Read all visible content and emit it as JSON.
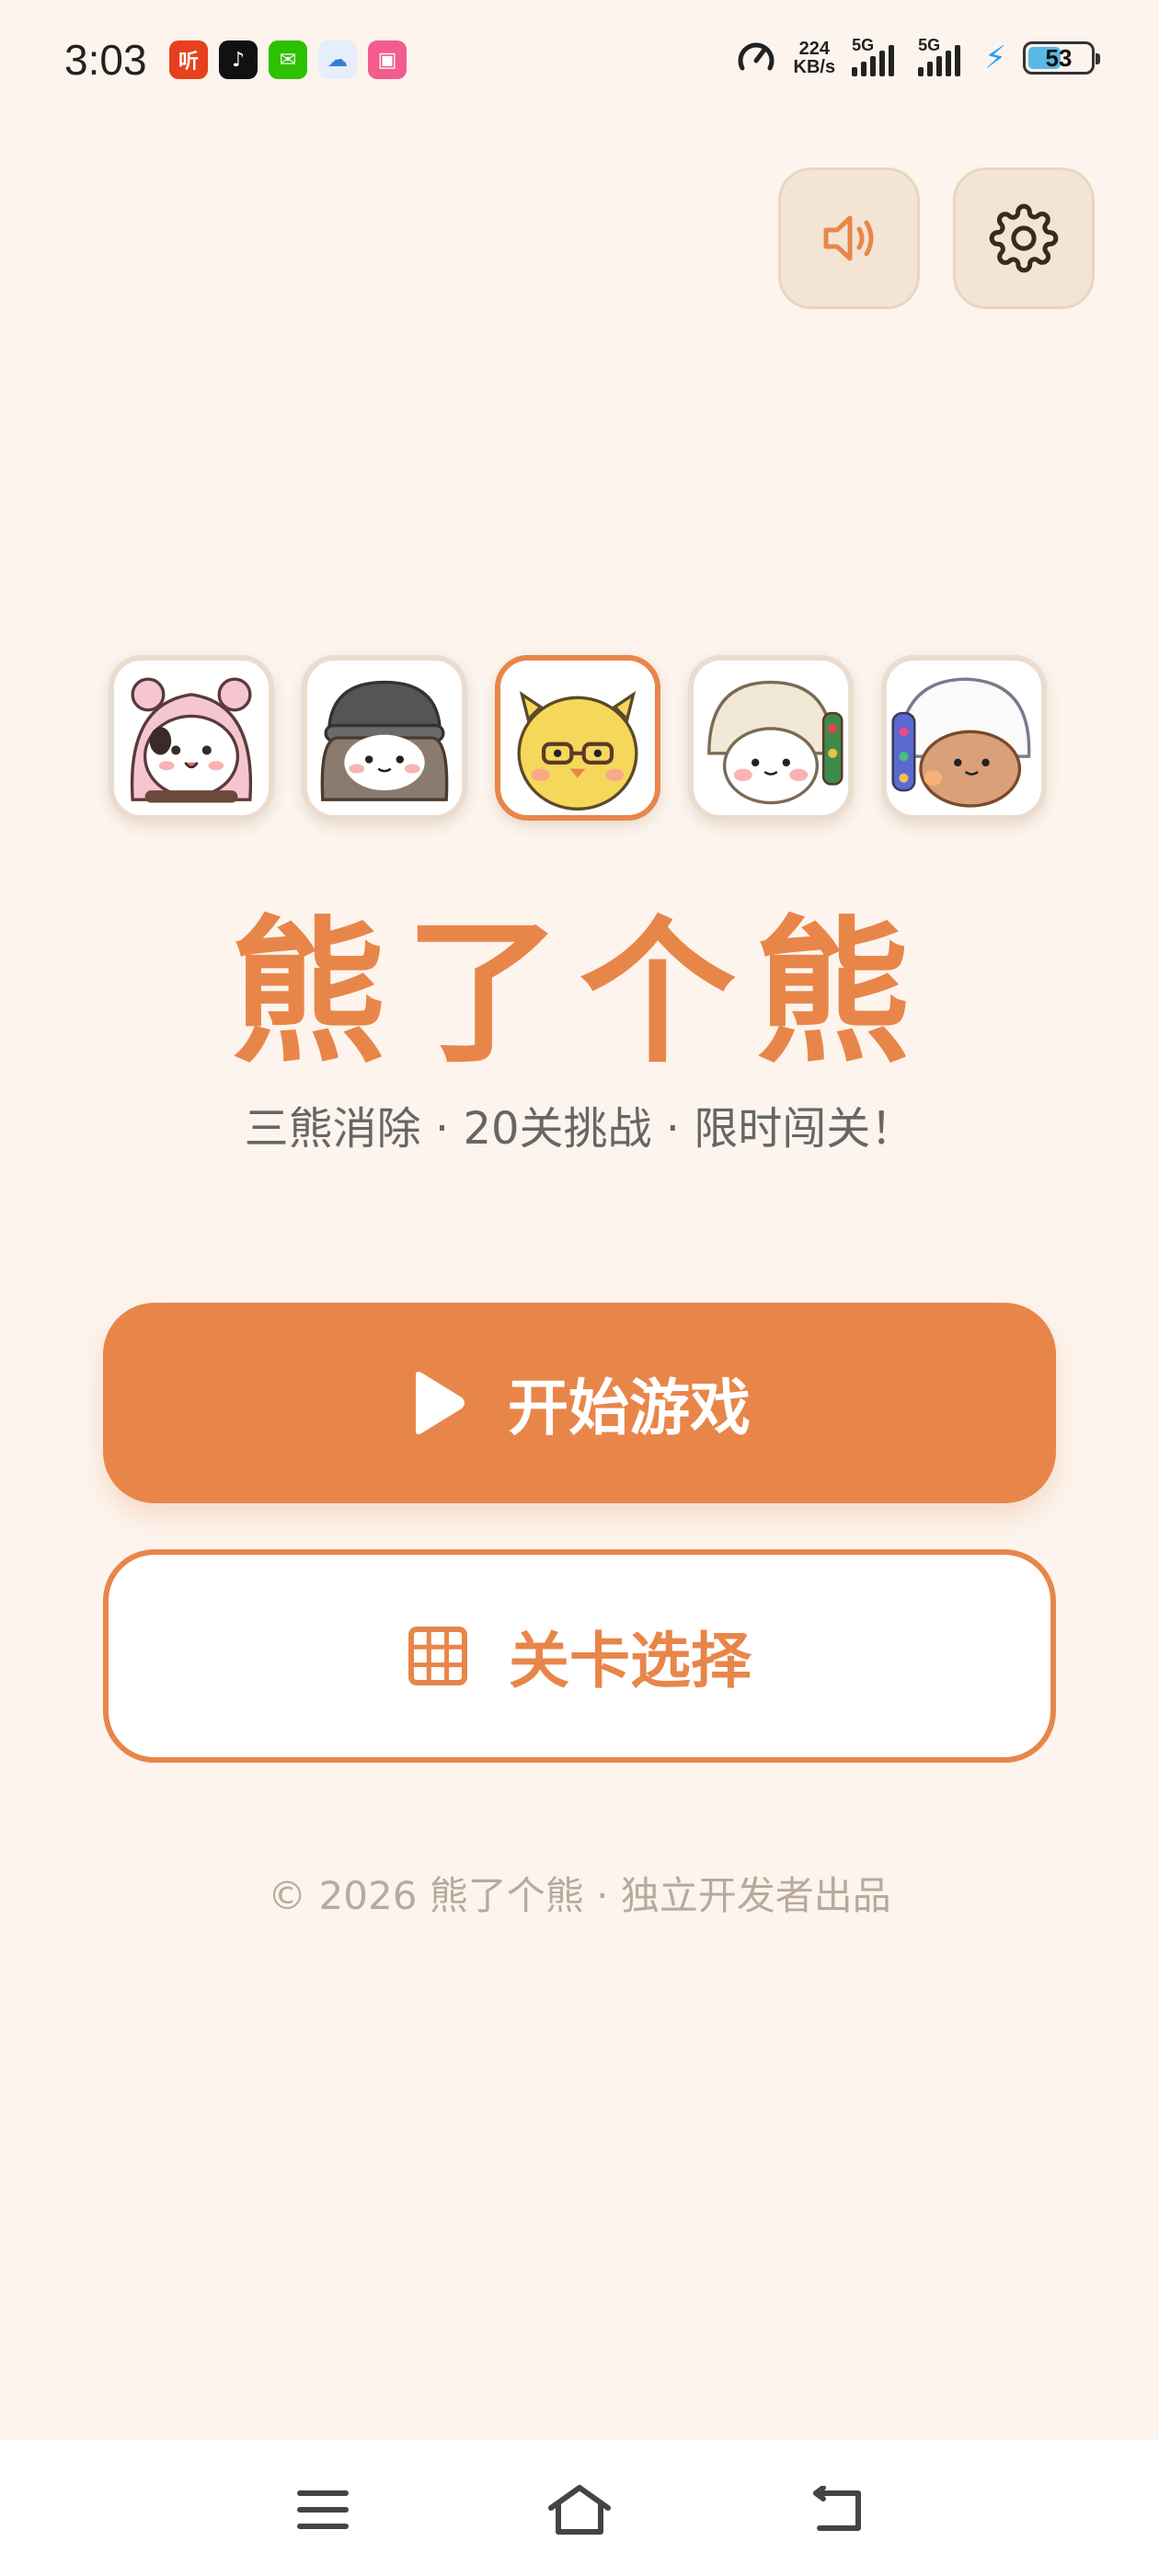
{
  "status_bar": {
    "time": "3:03",
    "network_speed_value": "224",
    "network_speed_unit": "KB/s",
    "signal_1_label": "5G",
    "signal_2_label": "5G",
    "battery_level": "53",
    "apps": [
      {
        "name": "listen-app",
        "glyph": "听",
        "color": "#e8401c"
      },
      {
        "name": "tiktok-app",
        "glyph": "♪",
        "color": "#111111"
      },
      {
        "name": "wechat-app",
        "glyph": "✉",
        "color": "#2dc100"
      },
      {
        "name": "cloud-app",
        "glyph": "☁",
        "color": "#3a7bd5"
      },
      {
        "name": "bili-app",
        "glyph": "▣",
        "color": "#f25d8e"
      }
    ]
  },
  "header": {
    "sound_icon": "speaker-icon",
    "settings_icon": "gear-icon"
  },
  "characters": [
    {
      "name": "pink-hood-bear",
      "selected": false
    },
    {
      "name": "beanie-bear",
      "selected": false
    },
    {
      "name": "yellow-chick-bear",
      "selected": true
    },
    {
      "name": "fur-hat-bear",
      "selected": false
    },
    {
      "name": "brown-fur-hat-bear",
      "selected": false
    }
  ],
  "title": "熊了个熊",
  "subtitle": "三熊消除 · 20关挑战 · 限时闯关！",
  "start_button": {
    "label": "开始游戏",
    "icon": "play-icon"
  },
  "level_button": {
    "label": "关卡选择",
    "icon": "grid-icon"
  },
  "footer": "© 2026 熊了个熊 · 独立开发者出品",
  "colors": {
    "accent": "#e8864a",
    "background": "#fcf4ed",
    "button_bg": "#f3e4d4"
  }
}
